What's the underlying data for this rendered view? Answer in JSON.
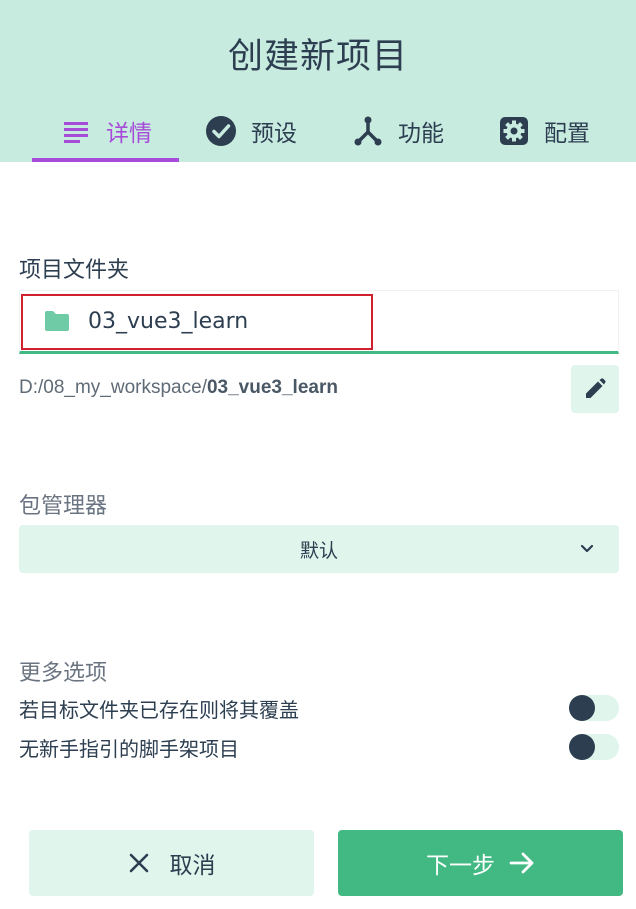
{
  "header": {
    "title": "创建新项目",
    "tabs": [
      {
        "label": "详情",
        "icon": "list-icon",
        "active": true
      },
      {
        "label": "预设",
        "icon": "check-circle-icon",
        "active": false
      },
      {
        "label": "功能",
        "icon": "fork-icon",
        "active": false
      },
      {
        "label": "配置",
        "icon": "gear-icon",
        "active": false
      }
    ]
  },
  "folder": {
    "label": "项目文件夹",
    "value": "03_vue3_learn",
    "path_prefix": "D:/08_my_workspace/",
    "path_name": "03_vue3_learn"
  },
  "package_manager": {
    "label": "包管理器",
    "selected": "默认"
  },
  "more_options": {
    "label": "更多选项",
    "items": [
      {
        "label": "若目标文件夹已存在则将其覆盖",
        "enabled": false
      },
      {
        "label": "无新手指引的脚手架项目",
        "enabled": false
      }
    ]
  },
  "actions": {
    "cancel_label": "取消",
    "next_label": "下一步"
  },
  "colors": {
    "header_bg": "#c8ebe0",
    "accent": "#a74bd9",
    "primary": "#42b983",
    "text": "#2c3e50",
    "highlight_box": "#d0222e"
  }
}
